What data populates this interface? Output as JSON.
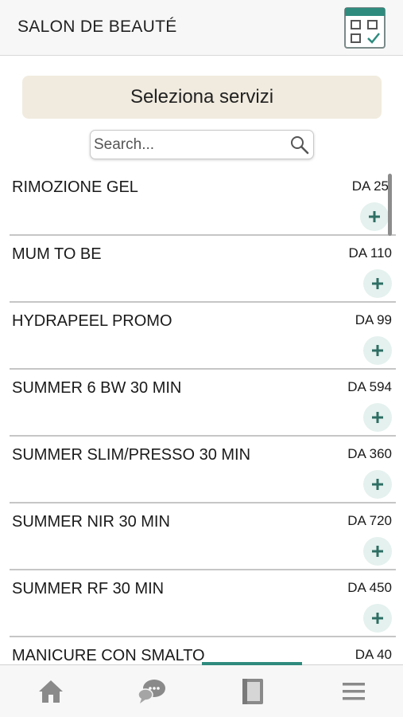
{
  "header": {
    "title": "SALON DE BEAUTÉ",
    "calendar_icon": "calendar-check-icon"
  },
  "section": {
    "title": "Seleziona servizi"
  },
  "search": {
    "placeholder": "Search...",
    "value": "",
    "icon": "search-icon"
  },
  "services": [
    {
      "name": "RIMOZIONE GEL",
      "price": "DA 25"
    },
    {
      "name": "MUM TO BE",
      "price": "DA 110"
    },
    {
      "name": "HYDRAPEEL PROMO",
      "price": "DA 99"
    },
    {
      "name": "SUMMER 6 BW 30 MIN",
      "price": "DA 594"
    },
    {
      "name": "SUMMER SLIM/PRESSO 30 MIN",
      "price": "DA 360"
    },
    {
      "name": "SUMMER NIR 30 MIN",
      "price": "DA 720"
    },
    {
      "name": "SUMMER RF 30 MIN",
      "price": "DA 450"
    },
    {
      "name": "MANICURE CON SMALTO",
      "price": "DA 40"
    }
  ],
  "bottom_nav": {
    "items": [
      {
        "icon": "home-icon"
      },
      {
        "icon": "chat-icon"
      },
      {
        "icon": "book-icon",
        "active": true
      },
      {
        "icon": "menu-icon"
      }
    ]
  },
  "colors": {
    "accent": "#2e8b7e",
    "banner_bg": "#f1ebdf",
    "add_bg": "#e4f1ee",
    "nav_icon": "#8a8a8a"
  }
}
